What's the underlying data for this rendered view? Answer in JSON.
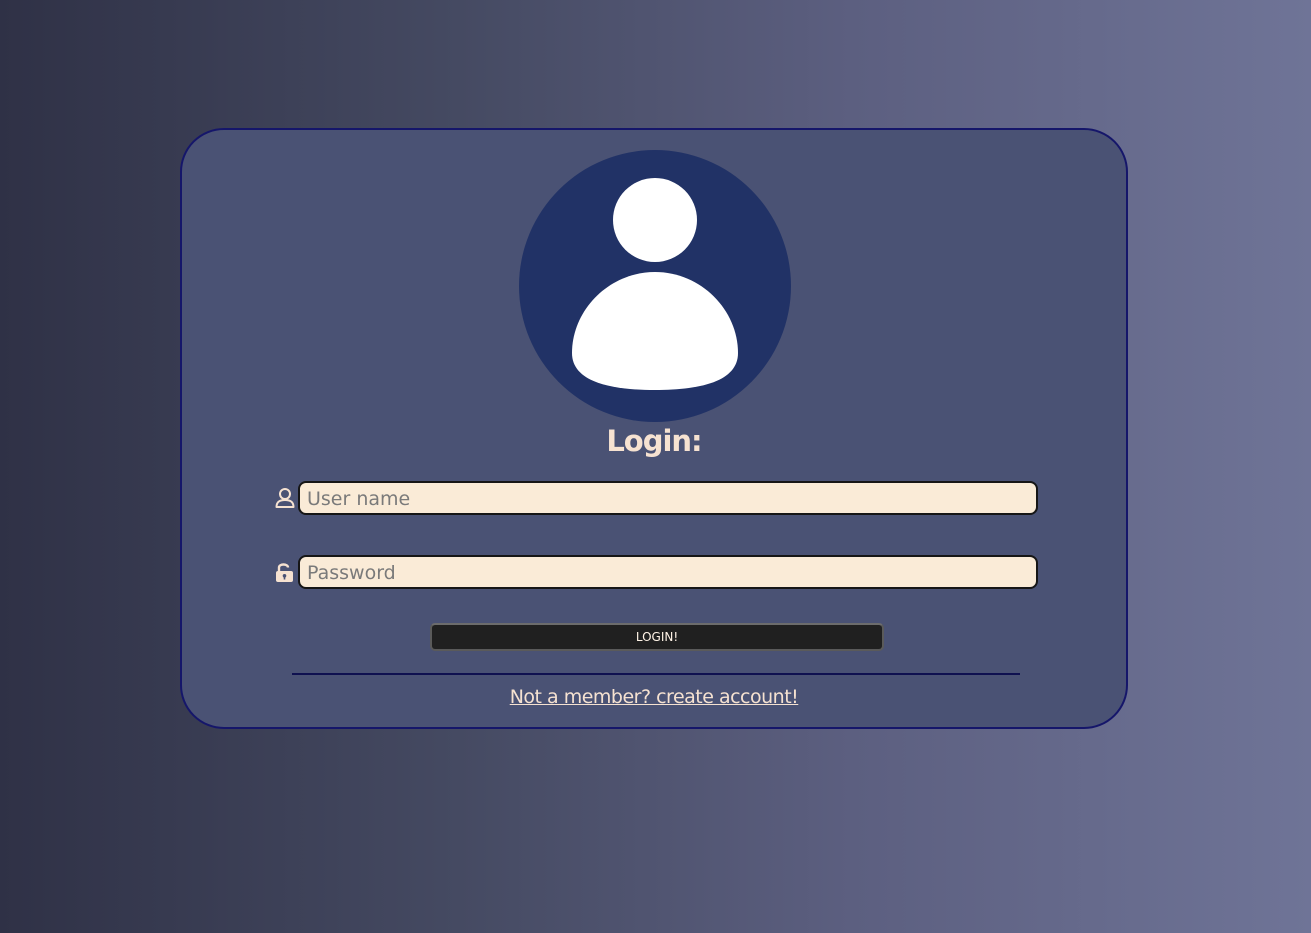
{
  "login_card": {
    "title": "Login:",
    "username": {
      "placeholder": "User name",
      "value": "",
      "icon": "user-icon"
    },
    "password": {
      "placeholder": "Password",
      "value": "",
      "icon": "unlock-icon"
    },
    "submit_label": "LOGIN!",
    "signup_link": "Not a member? create account!",
    "avatar_icon": "person-avatar-icon"
  },
  "colors": {
    "card_background": "#4a5274",
    "card_border": "#15166a",
    "avatar_background": "#213266",
    "input_background": "#faebd7",
    "text_light": "#f6e2d1",
    "button_background": "#202020"
  }
}
